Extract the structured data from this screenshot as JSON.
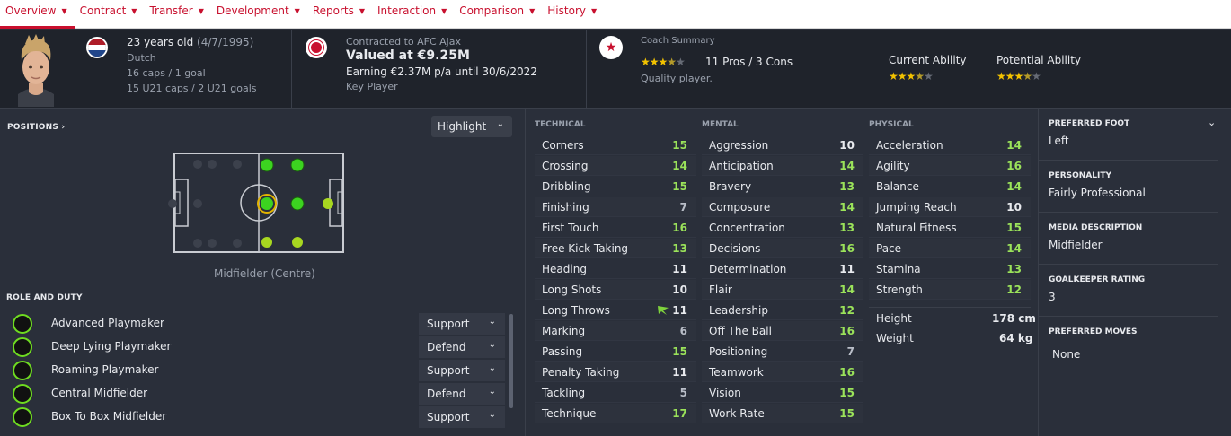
{
  "nav": [
    {
      "label": "Overview"
    },
    {
      "label": "Contract"
    },
    {
      "label": "Transfer"
    },
    {
      "label": "Development"
    },
    {
      "label": "Reports"
    },
    {
      "label": "Interaction"
    },
    {
      "label": "Comparison"
    },
    {
      "label": "History"
    }
  ],
  "player": {
    "age": "23 years old",
    "dob": "(4/7/1995)",
    "nationality": "Dutch",
    "caps": "16 caps / 1 goal",
    "u21": "15 U21 caps / 2 U21 goals"
  },
  "contract": {
    "line1": "Contracted to AFC Ajax",
    "value": "Valued at €9.25M",
    "earning": "Earning €2.37M p/a until 30/6/2022",
    "status": "Key Player"
  },
  "coach": {
    "title": "Coach Summary",
    "pros": "11 Pros / 3 Cons",
    "summary": "Quality player.",
    "stars": 3.5
  },
  "ability": {
    "current_label": "Current Ability",
    "potential_label": "Potential Ability",
    "current_stars": 3.5,
    "potential_stars": 3.5
  },
  "positions": {
    "title": "POSITIONS",
    "highlight": "Highlight",
    "position_name": "Midfielder (Centre)"
  },
  "roles": {
    "title": "ROLE AND DUTY",
    "items": [
      {
        "name": "Advanced Playmaker",
        "duty": "Support"
      },
      {
        "name": "Deep Lying Playmaker",
        "duty": "Defend"
      },
      {
        "name": "Roaming Playmaker",
        "duty": "Support"
      },
      {
        "name": "Central Midfielder",
        "duty": "Defend"
      },
      {
        "name": "Box To Box Midfielder",
        "duty": "Support"
      }
    ]
  },
  "technical": {
    "title": "TECHNICAL",
    "items": [
      {
        "name": "Corners",
        "value": "15"
      },
      {
        "name": "Crossing",
        "value": "14"
      },
      {
        "name": "Dribbling",
        "value": "15",
        "arrow": "down"
      },
      {
        "name": "Finishing",
        "value": "7"
      },
      {
        "name": "First Touch",
        "value": "16",
        "arrow": "down"
      },
      {
        "name": "Free Kick Taking",
        "value": "13"
      },
      {
        "name": "Heading",
        "value": "11"
      },
      {
        "name": "Long Shots",
        "value": "10",
        "arrow": "down"
      },
      {
        "name": "Long Throws",
        "value": "11",
        "arrow": "up"
      },
      {
        "name": "Marking",
        "value": "6"
      },
      {
        "name": "Passing",
        "value": "15",
        "arrow": "down"
      },
      {
        "name": "Penalty Taking",
        "value": "11"
      },
      {
        "name": "Tackling",
        "value": "5"
      },
      {
        "name": "Technique",
        "value": "17"
      }
    ]
  },
  "mental": {
    "title": "MENTAL",
    "items": [
      {
        "name": "Aggression",
        "value": "10"
      },
      {
        "name": "Anticipation",
        "value": "14"
      },
      {
        "name": "Bravery",
        "value": "13"
      },
      {
        "name": "Composure",
        "value": "14",
        "arrow": "down"
      },
      {
        "name": "Concentration",
        "value": "13"
      },
      {
        "name": "Decisions",
        "value": "16"
      },
      {
        "name": "Determination",
        "value": "11"
      },
      {
        "name": "Flair",
        "value": "14"
      },
      {
        "name": "Leadership",
        "value": "12"
      },
      {
        "name": "Off The Ball",
        "value": "16"
      },
      {
        "name": "Positioning",
        "value": "7"
      },
      {
        "name": "Teamwork",
        "value": "16",
        "arrow": "down"
      },
      {
        "name": "Vision",
        "value": "15",
        "arrow": "down"
      },
      {
        "name": "Work Rate",
        "value": "15"
      }
    ]
  },
  "physical": {
    "title": "PHYSICAL",
    "items": [
      {
        "name": "Acceleration",
        "value": "14",
        "arrow": "down"
      },
      {
        "name": "Agility",
        "value": "16"
      },
      {
        "name": "Balance",
        "value": "14"
      },
      {
        "name": "Jumping Reach",
        "value": "10"
      },
      {
        "name": "Natural Fitness",
        "value": "15"
      },
      {
        "name": "Pace",
        "value": "14"
      },
      {
        "name": "Stamina",
        "value": "13",
        "arrow": "down"
      },
      {
        "name": "Strength",
        "value": "12"
      }
    ],
    "height_label": "Height",
    "height": "178 cm",
    "weight_label": "Weight",
    "weight": "64 kg"
  },
  "info": {
    "foot_label": "PREFERRED FOOT",
    "foot": "Left",
    "personality_label": "PERSONALITY",
    "personality": "Fairly Professional",
    "media_label": "MEDIA DESCRIPTION",
    "media": "Midfielder",
    "gk_label": "GOALKEEPER RATING",
    "gk": "3",
    "moves_label": "PREFERRED MOVES",
    "moves": "None"
  }
}
